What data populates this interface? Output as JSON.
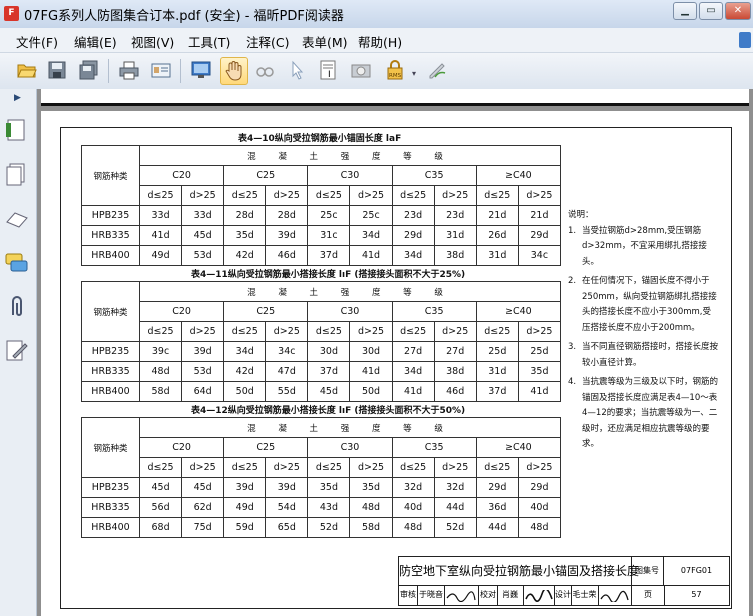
{
  "window": {
    "title": "07FG系列人防图集合订本.pdf (安全) - 福昕PDF阅读器",
    "app_icon_label": "F"
  },
  "menu": [
    "文件(F)",
    "编辑(E)",
    "视图(V)",
    "工具(T)",
    "注释(C)",
    "表单(M)",
    "帮助(H)"
  ],
  "icons": {
    "toolbar": [
      "open-folder-icon",
      "save-icon",
      "save-all-icon",
      "print-icon",
      "email-icon",
      "fullscreen-icon",
      "hand-tool-icon",
      "loupe-icon",
      "select-arrow-icon",
      "text-select-icon",
      "snapshot-icon",
      "rms-lock-icon",
      "sign-icon"
    ],
    "left": [
      "bookmarks-icon",
      "pages-icon",
      "layers-icon",
      "comments-icon",
      "attachments-icon",
      "signatures-icon"
    ]
  },
  "colors": {
    "selected_tool": "#ffd97a",
    "pdf_red": "#d8352a",
    "viewer_bg": "#8f8f8f"
  },
  "rms_label": "RMS",
  "tables": [
    {
      "title": "表4—10纵向受拉钢筋最小锚固长度 laF",
      "kind_label": "钢筋种类",
      "concrete_label": "混 凝 土 强 度 等 级",
      "grades": [
        "C20",
        "C25",
        "C30",
        "C35",
        "≥C40"
      ],
      "sub": [
        "d≤25",
        "d>25"
      ],
      "rows": [
        {
          "name": "HPB235",
          "values": [
            "33d",
            "33d",
            "28d",
            "28d",
            "25c",
            "25c",
            "23d",
            "23d",
            "21d",
            "21d"
          ]
        },
        {
          "name": "HRB335",
          "values": [
            "41d",
            "45d",
            "35d",
            "39d",
            "31c",
            "34d",
            "29d",
            "31d",
            "26d",
            "29d"
          ]
        },
        {
          "name": "HRB400",
          "values": [
            "49d",
            "53d",
            "42d",
            "46d",
            "37d",
            "41d",
            "34d",
            "38d",
            "31d",
            "34c"
          ]
        }
      ]
    },
    {
      "title": "表4—11纵向受拉钢筋最小搭接长度 lıF (搭接接头面积不大于25%)",
      "kind_label": "钢筋种类",
      "concrete_label": "混 凝 土 强 度 等 级",
      "grades": [
        "C20",
        "C25",
        "C30",
        "C35",
        "≥C40"
      ],
      "sub": [
        "d≤25",
        "d>25"
      ],
      "rows": [
        {
          "name": "HPB235",
          "values": [
            "39c",
            "39d",
            "34d",
            "34c",
            "30d",
            "30d",
            "27d",
            "27d",
            "25d",
            "25d"
          ]
        },
        {
          "name": "HRB335",
          "values": [
            "48d",
            "53d",
            "42d",
            "47d",
            "37d",
            "41d",
            "34d",
            "38d",
            "31d",
            "35d"
          ]
        },
        {
          "name": "HRB400",
          "values": [
            "58d",
            "64d",
            "50d",
            "55d",
            "45d",
            "50d",
            "41d",
            "46d",
            "37d",
            "41d"
          ]
        }
      ]
    },
    {
      "title": "表4—12纵向受拉钢筋最小搭接长度 lıF (搭接接头面积不大于50%)",
      "kind_label": "钢筋种类",
      "concrete_label": "混 凝 土 强 度 等 级",
      "grades": [
        "C20",
        "C25",
        "C30",
        "C35",
        "≥C40"
      ],
      "sub": [
        "d≤25",
        "d>25"
      ],
      "rows": [
        {
          "name": "HPB235",
          "values": [
            "45d",
            "45d",
            "39d",
            "39d",
            "35d",
            "35d",
            "32d",
            "32d",
            "29d",
            "29d"
          ]
        },
        {
          "name": "HRB335",
          "values": [
            "56d",
            "62d",
            "49d",
            "54d",
            "43d",
            "48d",
            "40d",
            "44d",
            "36d",
            "40d"
          ]
        },
        {
          "name": "HRB400",
          "values": [
            "68d",
            "75d",
            "59d",
            "65d",
            "52d",
            "58d",
            "48d",
            "52d",
            "44d",
            "48d"
          ]
        }
      ]
    }
  ],
  "notes": {
    "heading": "说明：",
    "items": [
      {
        "num": "1.",
        "text": "当受拉钢筋d>28mm,受压钢筋d>32mm，不宜采用绑扎搭接接头。"
      },
      {
        "num": "2.",
        "text": "在任何情况下，锚固长度不得小于250mm，纵向受拉钢筋绑扎搭接接头的搭接长度不应小于300mm,受压搭接长度不应小于200mm。"
      },
      {
        "num": "3.",
        "text": "当不同直径钢筋搭接时，搭接长度按较小直径计算。"
      },
      {
        "num": "4.",
        "text": "当抗震等级为三级及以下时，钢筋的锚固及搭接长度应满足表4—10～表4—12的要求；当抗震等级为一、二级时，还应满足相应抗震等级的要求。"
      }
    ]
  },
  "title_block": {
    "title": "防空地下室纵向受拉钢筋最小锚固及搭接长度",
    "atlas_label": "图集号",
    "atlas_no": "07FG01",
    "review_label": "审核",
    "reviewer": "于晓音",
    "check_label": "校对",
    "checker": "肖巍",
    "design_label": "设计",
    "designer": "毛士荣",
    "page_label": "页",
    "page_no": "57"
  }
}
